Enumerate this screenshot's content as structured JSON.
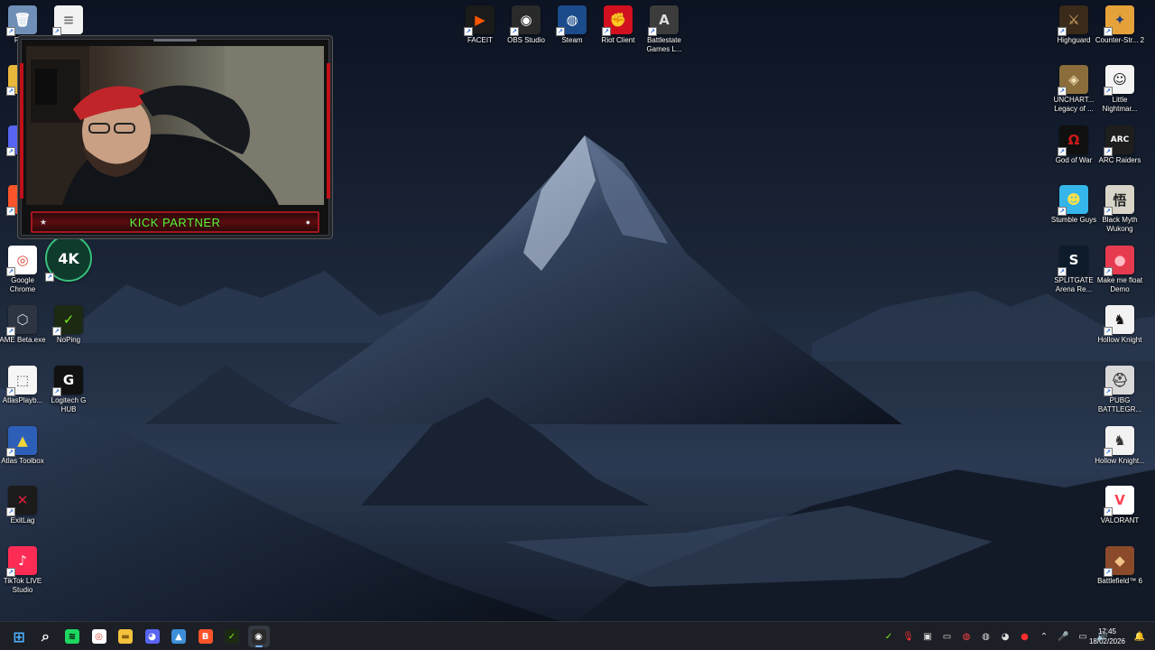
{
  "desktop": {
    "top_icons": [
      {
        "label": "FACEIT",
        "icon": "faceit-icon",
        "glyph": "▶",
        "bg": "#1b1b1b",
        "fg": "#ff5500"
      },
      {
        "label": "OBS Studio",
        "icon": "obs-icon",
        "glyph": "◉",
        "bg": "#2a2a2a",
        "fg": "#ffffff"
      },
      {
        "label": "Steam",
        "icon": "steam-icon",
        "glyph": "◍",
        "bg": "#1b4b8a",
        "fg": "#ffffff"
      },
      {
        "label": "Riot Client",
        "icon": "riot-icon",
        "glyph": "✊",
        "bg": "#d3101f",
        "fg": "#ffffff"
      },
      {
        "label": "Battlestate Games L...",
        "icon": "battlestate-icon",
        "glyph": "A",
        "bg": "#3c3c3c",
        "fg": "#dddddd"
      }
    ],
    "left_icons": [
      {
        "label": "Recy",
        "icon": "recycle-bin-icon",
        "glyph": "🗑",
        "bg": "#6f8fb6",
        "fg": "#ffffff"
      },
      {
        "label": "",
        "icon": "document-icon",
        "glyph": "≡",
        "bg": "#f2f2f2",
        "fg": "#777777"
      },
      {
        "label": "A",
        "icon": "folder-icon",
        "glyph": "▬",
        "bg": "#e8b63a",
        "fg": "#7a5a10"
      },
      {
        "label": "Di",
        "icon": "discord-icon",
        "glyph": "◕",
        "bg": "#5865f2",
        "fg": "#ffffff"
      },
      {
        "label": "Br",
        "icon": "brave-icon",
        "glyph": "B",
        "bg": "#fb542b",
        "fg": "#ffffff"
      },
      {
        "label": "Google Chrome",
        "icon": "chrome-icon",
        "glyph": "◎",
        "bg": "#ffffff",
        "fg": "#db4437"
      },
      {
        "label": "",
        "icon": "4k-streamers-icon",
        "glyph": "4K",
        "bg": "#0f3b2c",
        "fg": "#ffffff"
      },
      {
        "label": "AME Beta.exe",
        "icon": "ame-icon",
        "glyph": "⬡",
        "bg": "#2d3542",
        "fg": "#cfd8e3"
      },
      {
        "label": "NoPing",
        "icon": "noping-icon",
        "glyph": "✓",
        "bg": "#1c2a14",
        "fg": "#7dea1b"
      },
      {
        "label": "AtlasPlayb...",
        "icon": "atlas-playbook-icon",
        "glyph": "⬚",
        "bg": "#f6f6f6",
        "fg": "#555555"
      },
      {
        "label": "Logitech G HUB",
        "icon": "logitech-ghub-icon",
        "glyph": "G",
        "bg": "#111111",
        "fg": "#ffffff"
      },
      {
        "label": "Atlas Toolbox",
        "icon": "atlas-toolbox-icon",
        "glyph": "▲",
        "bg": "#2e5fb8",
        "fg": "#f2d43b"
      },
      {
        "label": "ExitLag",
        "icon": "exitlag-icon",
        "glyph": "✕",
        "bg": "#1b1b1b",
        "fg": "#e01f3d"
      },
      {
        "label": "TikTok LIVE Studio",
        "icon": "tiktok-live-icon",
        "glyph": "♪",
        "bg": "#fe2c55",
        "fg": "#ffffff"
      }
    ],
    "right_icons": [
      {
        "label": "Highguard",
        "icon": "highguard-icon",
        "glyph": "⚔",
        "bg": "#3a2a1a",
        "fg": "#e2b56a"
      },
      {
        "label": "Counter-Str... 2",
        "icon": "cs2-icon",
        "glyph": "✦",
        "bg": "#e5a13a",
        "fg": "#1c3b7c"
      },
      {
        "label": "UNCHART... Legacy of ...",
        "icon": "uncharted-icon",
        "glyph": "◈",
        "bg": "#8a6d3b",
        "fg": "#f1deb0"
      },
      {
        "label": "Little Nightmar...",
        "icon": "little-nightmares-icon",
        "glyph": "☺",
        "bg": "#f4f4f4",
        "fg": "#111111"
      },
      {
        "label": "God of War",
        "icon": "god-of-war-icon",
        "glyph": "Ω",
        "bg": "#101010",
        "fg": "#cc1a1a"
      },
      {
        "label": "ARC Raiders",
        "icon": "arc-raiders-icon",
        "glyph": "ARC",
        "bg": "#1e1e1e",
        "fg": "#ffffff"
      },
      {
        "label": "Stumble Guys",
        "icon": "stumble-guys-icon",
        "glyph": "☻",
        "bg": "#34b6ea",
        "fg": "#ffe14a"
      },
      {
        "label": "Black Myth Wukong",
        "icon": "black-myth-wukong-icon",
        "glyph": "悟",
        "bg": "#d8d4c8",
        "fg": "#222222"
      },
      {
        "label": "SPLITGATE Arena Re...",
        "icon": "splitgate-icon",
        "glyph": "S",
        "bg": "#0d1b2a",
        "fg": "#ffffff"
      },
      {
        "label": "Make me float Demo",
        "icon": "make-me-float-icon",
        "glyph": "●",
        "bg": "#e63b4e",
        "fg": "#ffbac3"
      },
      {
        "label": "Hollow Knight",
        "icon": "hollow-knight-icon",
        "glyph": "♞",
        "bg": "#f2f2f2",
        "fg": "#111111"
      },
      {
        "label": "PUBG BATTLEGR...",
        "icon": "pubg-icon",
        "glyph": "⛑",
        "bg": "#d9d9d9",
        "fg": "#444444"
      },
      {
        "label": "Hollow Knight...",
        "icon": "hollow-knight-silksong-icon",
        "glyph": "♞",
        "bg": "#f2f2f2",
        "fg": "#333333"
      },
      {
        "label": "VALORANT",
        "icon": "valorant-icon",
        "glyph": "V",
        "bg": "#ffffff",
        "fg": "#fa4454"
      },
      {
        "label": "Battlefield™ 6",
        "icon": "battlefield-6-icon",
        "glyph": "◆",
        "bg": "#8b4b2b",
        "fg": "#f2c48a"
      }
    ]
  },
  "overlay": {
    "banner_text": "KICK PARTNER"
  },
  "taskbar": {
    "buttons": [
      {
        "icon": "windows-start-icon",
        "glyph": "⊞",
        "bg": "transparent",
        "fg": "#4fb3ff"
      },
      {
        "icon": "search-icon",
        "glyph": "⌕",
        "bg": "transparent",
        "fg": "#ffffff"
      },
      {
        "icon": "spotify-icon",
        "glyph": "≋",
        "bg": "#1ed760",
        "fg": "#000000"
      },
      {
        "icon": "chrome-icon",
        "glyph": "◎",
        "bg": "#ffffff",
        "fg": "#db4437"
      },
      {
        "icon": "file-explorer-icon",
        "glyph": "▬",
        "bg": "#f4c13d",
        "fg": "#8a6112"
      },
      {
        "icon": "discord-icon",
        "glyph": "◕",
        "bg": "#5865f2",
        "fg": "#ffffff"
      },
      {
        "icon": "photos-icon",
        "glyph": "▲",
        "bg": "#3c8ed8",
        "fg": "#ffffff"
      },
      {
        "icon": "brave-icon",
        "glyph": "B",
        "bg": "#fb542b",
        "fg": "#ffffff"
      },
      {
        "icon": "noping-icon",
        "glyph": "✓",
        "bg": "#1c2a14",
        "fg": "#7dea1b"
      },
      {
        "icon": "obs-icon",
        "glyph": "◉",
        "bg": "#2a2a2a",
        "fg": "#ffffff"
      }
    ],
    "tray": [
      {
        "icon": "noping-tray-icon",
        "glyph": "✓",
        "fg": "#7dea1b"
      },
      {
        "icon": "microphone-red-icon",
        "glyph": "🎙",
        "fg": "#ff3030"
      },
      {
        "icon": "app-tray-icon",
        "glyph": "▣",
        "fg": "#dddddd"
      },
      {
        "icon": "display-tray-icon",
        "glyph": "▭",
        "fg": "#dddddd"
      },
      {
        "icon": "riot-tray-icon",
        "glyph": "◍",
        "fg": "#ff4040"
      },
      {
        "icon": "steam-tray-icon",
        "glyph": "◍",
        "fg": "#dddddd"
      },
      {
        "icon": "discord-tray-icon",
        "glyph": "◕",
        "fg": "#dddddd"
      },
      {
        "icon": "recording-tray-icon",
        "glyph": "●",
        "fg": "#ff2d2d"
      },
      {
        "icon": "chevron-up-icon",
        "glyph": "⌃",
        "fg": "#dddddd"
      },
      {
        "icon": "microphone-icon",
        "glyph": "🎤",
        "fg": "#dddddd"
      },
      {
        "icon": "network-icon",
        "glyph": "▭",
        "fg": "#dddddd"
      },
      {
        "icon": "volume-icon",
        "glyph": "🔊",
        "fg": "#dddddd"
      }
    ],
    "clock": {
      "time": "17:45",
      "date": "18/02/2026"
    },
    "notification_icon": "notification-bell-icon"
  }
}
